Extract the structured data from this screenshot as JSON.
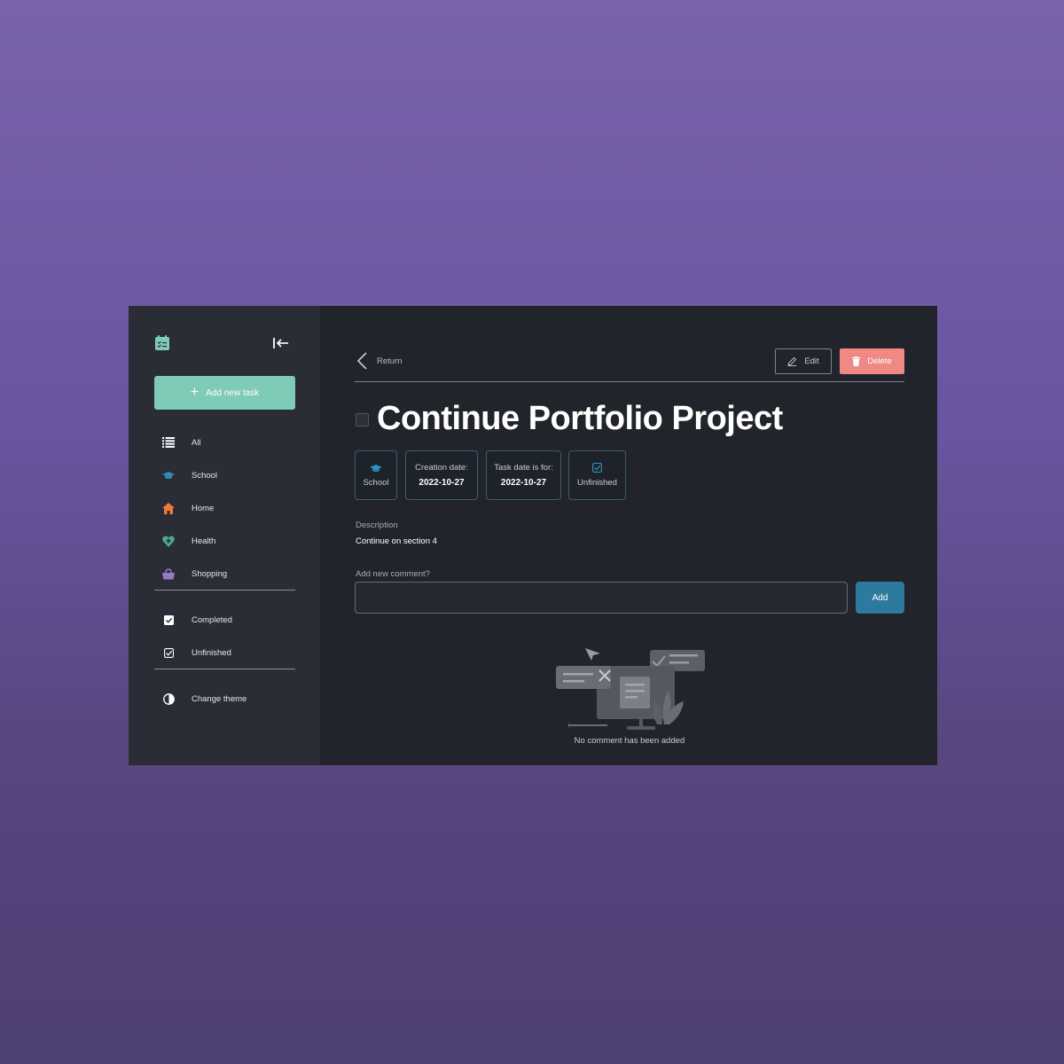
{
  "sidebar": {
    "logo_icon": "checklist-calendar-icon",
    "collapse_icon": "collapse-left-icon",
    "add_task_label": "Add new task",
    "categories": [
      {
        "label": "All",
        "icon": "list-icon"
      },
      {
        "label": "School",
        "icon": "graduation-cap-icon",
        "color": "#2f8fbf"
      },
      {
        "label": "Home",
        "icon": "house-icon",
        "color": "#f07a3a"
      },
      {
        "label": "Health",
        "icon": "heart-plus-icon",
        "color": "#4aa893"
      },
      {
        "label": "Shopping",
        "icon": "basket-icon",
        "color": "#9a78c9"
      }
    ],
    "filters": [
      {
        "label": "Completed",
        "icon": "checkbox-filled-icon"
      },
      {
        "label": "Unfinished",
        "icon": "checkbox-outline-icon"
      }
    ],
    "theme_label": "Change theme",
    "theme_icon": "contrast-icon"
  },
  "header": {
    "return_label": "Return",
    "edit_label": "Edit",
    "delete_label": "Delete"
  },
  "task": {
    "title": "Continue Portfolio Project",
    "category": "School",
    "creation_label": "Creation date:",
    "creation_date": "2022-10-27",
    "due_label": "Task date is for:",
    "due_date": "2022-10-27",
    "status": "Unfinished",
    "description_label": "Description",
    "description": "Continue on section 4"
  },
  "comments": {
    "label": "Add new comment?",
    "input_value": "",
    "add_label": "Add",
    "empty_text": "No comment has been added"
  },
  "colors": {
    "accent_green": "#7ecbb7",
    "delete_red": "#f08883",
    "add_blue": "#2e7a9e",
    "panel_bg": "#21242b",
    "sidebar_bg": "#2a2d35"
  }
}
